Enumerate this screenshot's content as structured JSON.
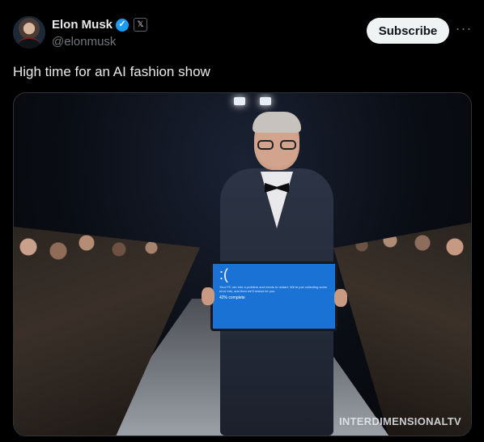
{
  "author": {
    "display_name": "Elon Musk",
    "handle": "@elonmusk",
    "verified_icon": "verified-badge-icon",
    "affiliate_icon": "x-logo-icon",
    "affiliate_glyph": "𝕏",
    "verified_glyph": "✓"
  },
  "actions": {
    "subscribe_label": "Subscribe",
    "more_glyph": "···"
  },
  "tweet": {
    "text": "High time for an AI fashion show"
  },
  "media": {
    "screen": {
      "face": ":(",
      "message": "Your PC ran into a problem and needs to restart. We're just collecting some error info, and then we'll restart for you.",
      "progress": "42% complete"
    },
    "watermark": "INTERDIMENSIONALTV"
  },
  "colors": {
    "background": "#000000",
    "text": "#e7e9ea",
    "muted": "#71767b",
    "verified_blue": "#1d9bf0",
    "subscribe_bg": "#eff3f4"
  }
}
